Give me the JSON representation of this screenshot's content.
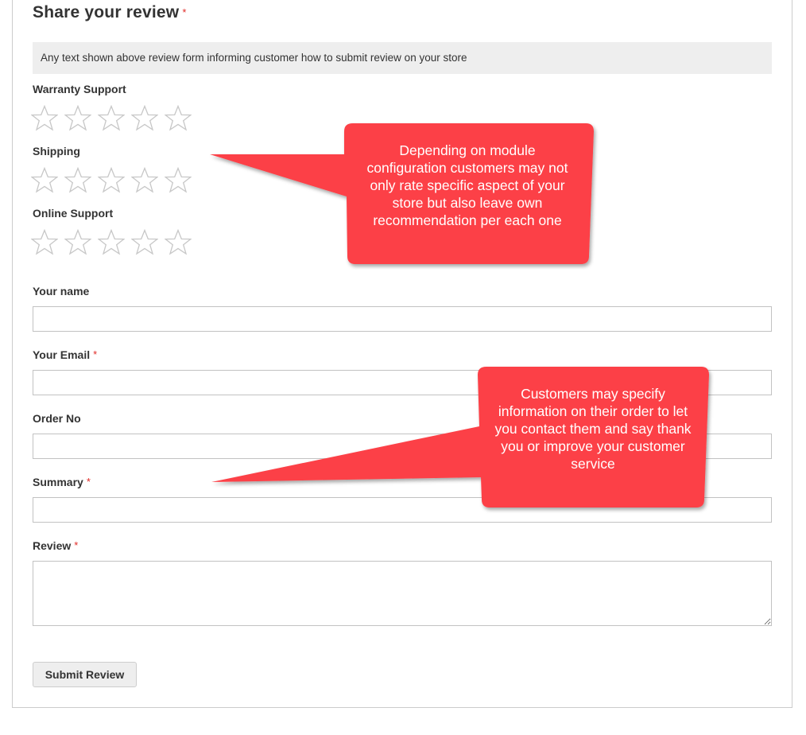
{
  "form": {
    "title": "Share your review",
    "title_required_mark": "*",
    "notice": "Any text shown above review form informing customer how to submit review on your store",
    "ratings": [
      {
        "label": "Warranty Support",
        "stars": 5
      },
      {
        "label": "Shipping",
        "stars": 5
      },
      {
        "label": "Online Support",
        "stars": 5
      }
    ],
    "fields": {
      "name": {
        "label": "Your name",
        "value": "",
        "required": false
      },
      "email": {
        "label": "Your Email",
        "value": "",
        "required": true,
        "required_mark": "*"
      },
      "order": {
        "label": "Order No",
        "value": "",
        "required": false
      },
      "summary": {
        "label": "Summary",
        "value": "",
        "required": true,
        "required_mark": "*"
      },
      "review": {
        "label": "Review",
        "value": "",
        "required": true,
        "required_mark": "*"
      }
    },
    "submit_label": "Submit Review"
  },
  "callouts": {
    "ratings_note": "Depending on module configuration customers may not only rate specific aspect of your store but also leave own recommendation per each one",
    "order_note": "Customers may specify information on their order to let you contact them and say thank you or improve your customer service"
  },
  "colors": {
    "callout": "#fc4146",
    "required": "#e02b27",
    "notice_bg": "#eeeeee",
    "star_outline": "#c7c7c7"
  },
  "icons": {
    "star": "empty-star-icon",
    "resize": "resize-grip-icon"
  }
}
